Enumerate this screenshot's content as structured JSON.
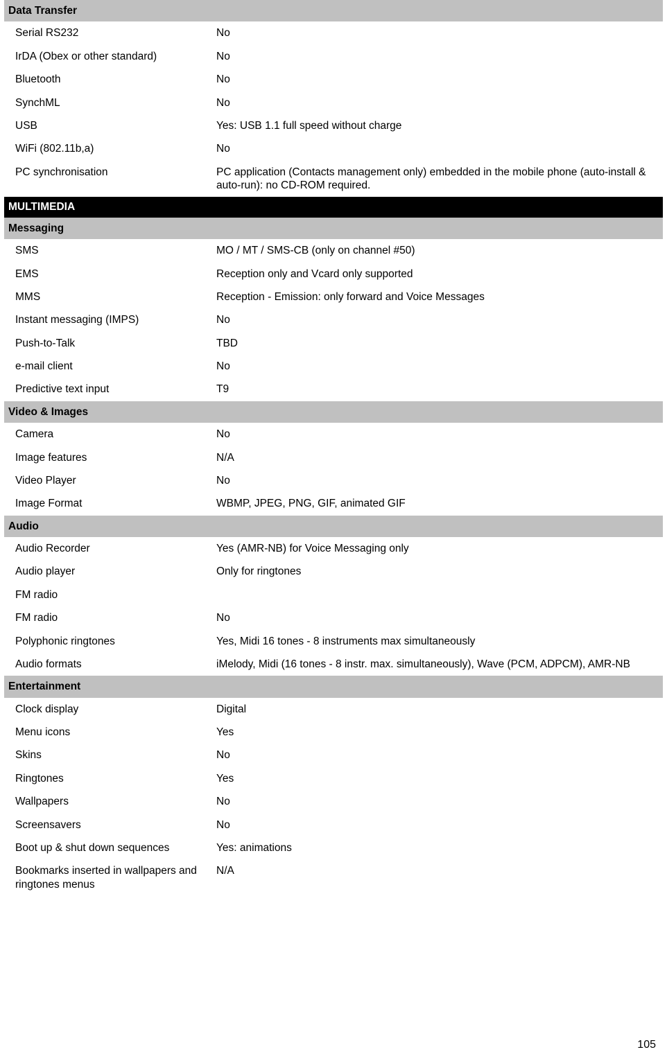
{
  "document": {
    "page_number": "105",
    "rows": [
      {
        "type": "group-header",
        "label": "Data Transfer",
        "value": ""
      },
      {
        "type": "data",
        "label": "Serial RS232",
        "value": "No"
      },
      {
        "type": "data",
        "label": "IrDA (Obex or other standard)",
        "value": "No"
      },
      {
        "type": "data",
        "label": "Bluetooth",
        "value": "No"
      },
      {
        "type": "data",
        "label": "SynchML",
        "value": "No"
      },
      {
        "type": "data",
        "label": "USB",
        "value": "Yes: USB 1.1 full speed without charge"
      },
      {
        "type": "data",
        "label": "WiFi (802.11b,a)",
        "value": "No"
      },
      {
        "type": "data",
        "label": "PC synchronisation",
        "value": "PC application (Contacts management only) embedded in the mobile phone (auto-install & auto-run): no CD-ROM required."
      },
      {
        "type": "section-header",
        "label": "MULTIMEDIA",
        "value": ""
      },
      {
        "type": "group-header",
        "label": "Messaging",
        "value": ""
      },
      {
        "type": "data",
        "label": "SMS",
        "value": "MO / MT / SMS-CB (only on channel #50)"
      },
      {
        "type": "data",
        "label": "EMS",
        "value": "Reception only and Vcard only supported"
      },
      {
        "type": "data",
        "label": "MMS",
        "value": "Reception - Emission: only forward and Voice Messages"
      },
      {
        "type": "data",
        "label": "Instant messaging (IMPS)",
        "value": "No"
      },
      {
        "type": "data",
        "label": "Push-to-Talk",
        "value": "TBD"
      },
      {
        "type": "data",
        "label": "e-mail client",
        "value": "No"
      },
      {
        "type": "data",
        "label": "Predictive text input",
        "value": "T9"
      },
      {
        "type": "group-header",
        "label": "Video & Images",
        "value": ""
      },
      {
        "type": "data",
        "label": "Camera",
        "value": "No"
      },
      {
        "type": "data",
        "label": "Image features",
        "value": "N/A"
      },
      {
        "type": "data",
        "label": "Video Player",
        "value": "No"
      },
      {
        "type": "data",
        "label": "Image Format",
        "value": "WBMP, JPEG, PNG, GIF, animated GIF"
      },
      {
        "type": "group-header",
        "label": "Audio",
        "value": ""
      },
      {
        "type": "data",
        "label": "Audio Recorder",
        "value": "Yes (AMR-NB) for Voice Messaging only"
      },
      {
        "type": "data",
        "label": "Audio player",
        "value": "Only for ringtones"
      },
      {
        "type": "data",
        "label": "FM radio",
        "value": ""
      },
      {
        "type": "data",
        "label": "FM radio",
        "value": "No"
      },
      {
        "type": "data",
        "label": "Polyphonic ringtones",
        "value": "Yes, Midi 16 tones - 8 instruments max simultaneously"
      },
      {
        "type": "data",
        "label": "Audio formats",
        "value": "iMelody, Midi (16 tones - 8 instr. max. simultaneously), Wave (PCM, ADPCM), AMR-NB"
      },
      {
        "type": "group-header",
        "label": "Entertainment",
        "value": ""
      },
      {
        "type": "data",
        "label": "Clock display",
        "value": "Digital"
      },
      {
        "type": "data",
        "label": "Menu icons",
        "value": "Yes"
      },
      {
        "type": "data",
        "label": "Skins",
        "value": "No"
      },
      {
        "type": "data",
        "label": "Ringtones",
        "value": "Yes"
      },
      {
        "type": "data",
        "label": "Wallpapers",
        "value": "No"
      },
      {
        "type": "data",
        "label": "Screensavers",
        "value": "No"
      },
      {
        "type": "data",
        "label": "Boot up & shut down sequences",
        "value": "Yes: animations"
      },
      {
        "type": "data",
        "label": "Bookmarks inserted in wallpapers and ringtones menus",
        "value": "N/A"
      }
    ]
  }
}
